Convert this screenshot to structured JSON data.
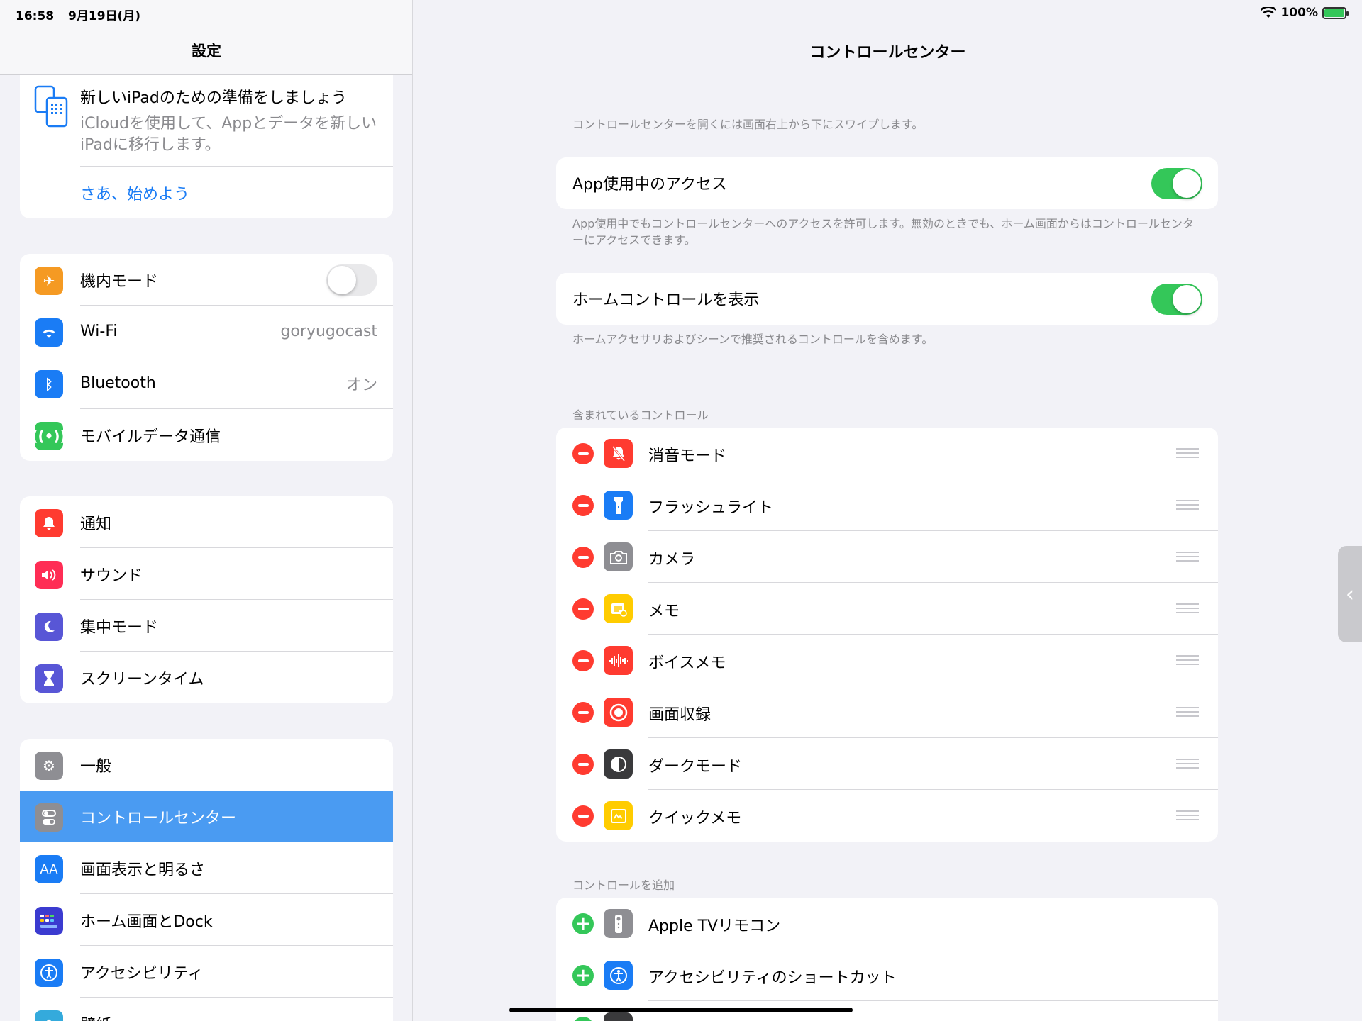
{
  "status": {
    "time": "16:58",
    "date": "9月19日(月)",
    "battery": "100%"
  },
  "sidebar": {
    "title": "設定",
    "promo": {
      "title": "新しいiPadのための準備をしましょう",
      "desc": "iCloudを使用して、Appとデータを新しいiPadに移行します。",
      "link": "さあ、始めよう"
    },
    "group1": [
      {
        "label": "機内モード",
        "icon": "airplane-icon",
        "color": "#f59a23"
      },
      {
        "label": "Wi-Fi",
        "value": "goryugocast",
        "icon": "wifi-icon",
        "color": "#1a7cf5"
      },
      {
        "label": "Bluetooth",
        "value": "オン",
        "icon": "bluetooth-icon",
        "color": "#1a7cf5"
      },
      {
        "label": "モバイルデータ通信",
        "icon": "antenna-icon",
        "color": "#34c759"
      }
    ],
    "group2": [
      {
        "label": "通知",
        "icon": "bell-icon",
        "color": "#ff3b30"
      },
      {
        "label": "サウンド",
        "icon": "speaker-icon",
        "color": "#ff2d55"
      },
      {
        "label": "集中モード",
        "icon": "moon-icon",
        "color": "#5856d6"
      },
      {
        "label": "スクリーンタイム",
        "icon": "hourglass-icon",
        "color": "#5856d6"
      }
    ],
    "group3": [
      {
        "label": "一般",
        "icon": "gear-icon",
        "color": "#8e8e93"
      },
      {
        "label": "コントロールセンター",
        "icon": "switches-icon",
        "color": "#8e8e93"
      },
      {
        "label": "画面表示と明るさ",
        "icon": "text-size-icon",
        "color": "#1a7cf5",
        "glyph": "AA"
      },
      {
        "label": "ホーム画面とDock",
        "icon": "grid-icon",
        "color": "#3b3bd0"
      },
      {
        "label": "アクセシビリティ",
        "icon": "accessibility-icon",
        "color": "#1a7cf5"
      },
      {
        "label": "壁紙",
        "icon": "flower-icon",
        "color": "#34aadc"
      }
    ]
  },
  "main": {
    "title": "コントロールセンター",
    "intro": "コントロールセンターを開くには画面右上から下にスワイプします。",
    "access": {
      "label": "App使用中のアクセス",
      "on": true,
      "note": "App使用中でもコントロールセンターへのアクセスを許可します。無効のときでも、ホーム画面からはコントロールセンターにアクセスできます。"
    },
    "home": {
      "label": "ホームコントロールを表示",
      "on": true,
      "note": "ホームアクセサリおよびシーンで推奨されるコントロールを含めます。"
    },
    "included_head": "含まれているコントロール",
    "included": [
      {
        "label": "消音モード",
        "icon": "bell-slash-icon",
        "color": "#ff3b30"
      },
      {
        "label": "フラッシュライト",
        "icon": "flashlight-icon",
        "color": "#1a7cf5"
      },
      {
        "label": "カメラ",
        "icon": "camera-icon",
        "color": "#8e8e93"
      },
      {
        "label": "メモ",
        "icon": "note-icon",
        "color": "#ffcc00"
      },
      {
        "label": "ボイスメモ",
        "icon": "waveform-icon",
        "color": "#ff3b30"
      },
      {
        "label": "画面収録",
        "icon": "record-icon",
        "color": "#ff3b30"
      },
      {
        "label": "ダークモード",
        "icon": "dark-mode-icon",
        "color": "#3a3a3c"
      },
      {
        "label": "クイックメモ",
        "icon": "quick-note-icon",
        "color": "#ffcc00"
      }
    ],
    "add_head": "コントロールを追加",
    "add": [
      {
        "label": "Apple TVリモコン",
        "icon": "remote-icon",
        "color": "#8e8e93"
      },
      {
        "label": "アクセシビリティのショートカット",
        "icon": "accessibility-icon",
        "color": "#1a7cf5"
      }
    ]
  }
}
